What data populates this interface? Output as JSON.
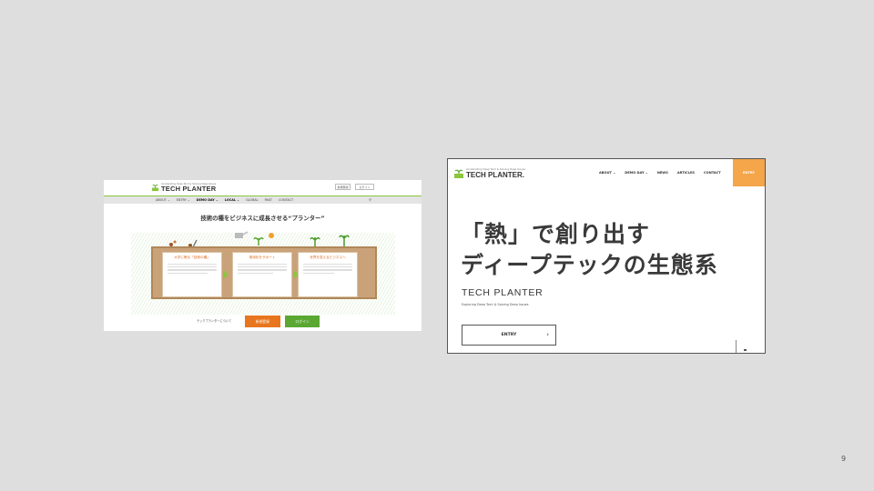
{
  "left_site": {
    "logo_tagline": "Accelerating Deep Tech & Solving Deep Issues",
    "logo_name": "TECH PLANTER",
    "header_buttons": [
      "新規登録",
      "ログイン"
    ],
    "nav_items": [
      {
        "label": "ABOUT ⌄",
        "bold": false
      },
      {
        "label": "ENTRY ⌄",
        "bold": false
      },
      {
        "label": "DEMO DAY ⌄",
        "bold": true
      },
      {
        "label": "LOCAL ⌄",
        "bold": true
      },
      {
        "label": "GLOBAL",
        "bold": false
      },
      {
        "label": "PAST",
        "bold": false
      },
      {
        "label": "CONTACT",
        "bold": false
      }
    ],
    "hero_title": "技術の種をビジネスに成長させる“プランター”",
    "steps": [
      {
        "title": "大学に眠る「技術の種」"
      },
      {
        "title": "実用化をサポート"
      },
      {
        "title": "世界を変えるビジネスへ"
      }
    ],
    "footer_link": "テックプランターについて",
    "register_button": "新規登録",
    "login_button": "ログイン",
    "colors": {
      "accent_green": "#8cc63f",
      "orange": "#e8761e",
      "login_green": "#5aa832"
    }
  },
  "right_site": {
    "logo_tagline": "Accelerating Deep Tech & Solving Deep Issues",
    "logo_name": "TECH PLANTER.",
    "nav_items": [
      "ABOUT ⌄",
      "DEMO DAY ⌄",
      "NEWS",
      "ARTICLES",
      "CONTACT"
    ],
    "entry_top": "ENTRY",
    "headline_line1": "「熱」で創り出す",
    "headline_line2": "ディープテックの生態系",
    "brand": "TECH PLANTER",
    "subtitle": "Exploring Deep Tech & Solving Deep Issues",
    "entry_button": "ENTRY",
    "entry_chevron": "›",
    "colors": {
      "entry_orange": "#f5a54a"
    }
  },
  "page_number": "9"
}
